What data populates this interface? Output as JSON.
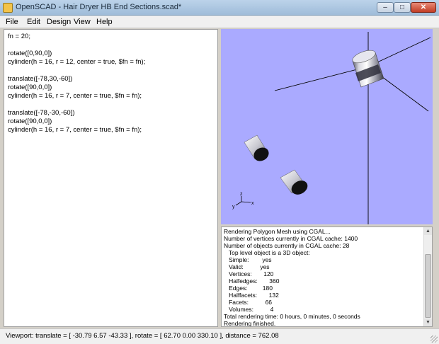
{
  "window": {
    "title": "OpenSCAD - Hair Dryer HB End Sections.scad*",
    "controls": {
      "minimize": "–",
      "maximize": "□",
      "close": "✕"
    },
    "icon": "openscad-app-icon"
  },
  "menu": [
    "File",
    "Edit",
    "Design",
    "View",
    "Help"
  ],
  "editor": {
    "lines": [
      "fn = 20;",
      "",
      "rotate([0,90,0])",
      "cylinder(h = 16, r = 12, center = true, $fn = fn);",
      "",
      "translate([-78,30,-60])",
      "rotate([90,0,0])",
      "cylinder(h = 16, r = 7, center = true, $fn = fn);",
      "",
      "translate([-78,-30,-60])",
      "rotate([90,0,0])",
      "cylinder(h = 16, r = 7, center = true, $fn = fn);"
    ]
  },
  "viewport": {
    "background": "#aaaaff",
    "axis_labels": {
      "x": "x",
      "y": "y",
      "z": "z"
    }
  },
  "console": {
    "lines": [
      "Rendering Polygon Mesh using CGAL...",
      "Number of vertices currently in CGAL cache: 1400",
      "Number of objects currently in CGAL cache: 28",
      "   Top level object is a 3D object:",
      "   Simple:        yes",
      "   Valid:          yes",
      "   Vertices:       120",
      "   Halfedges:       360",
      "   Edges:         180",
      "   Halffacets:       132",
      "   Facets:          66",
      "   Volumes:          4",
      "Total rendering time: 0 hours, 0 minutes, 0 seconds",
      "Rendering finished."
    ]
  },
  "scroll": {
    "up": "▲",
    "down": "▼"
  },
  "status": {
    "text": "Viewport: translate = [ -30.79 6.57 -43.33 ], rotate = [ 62.70 0.00 330.10 ], distance = 762.08"
  }
}
